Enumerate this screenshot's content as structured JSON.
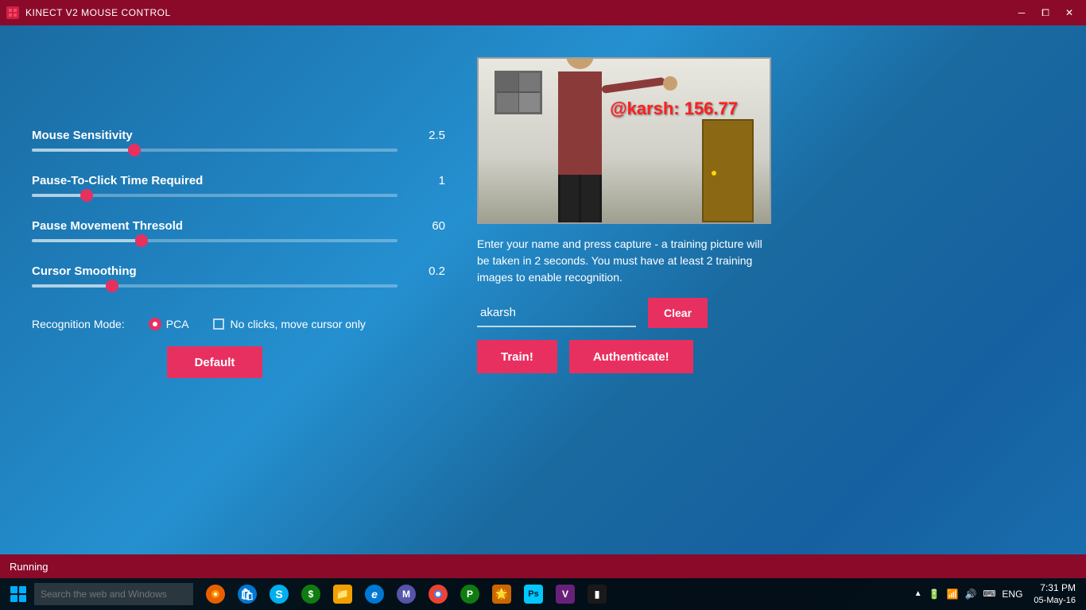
{
  "titleBar": {
    "title": "KINECT V2 MOUSE CONTROL",
    "minBtn": "─",
    "maxBtn": "⧠",
    "closeBtn": "✕"
  },
  "sliders": [
    {
      "label": "Mouse Sensitivity",
      "value": "2.5",
      "thumbPercent": 28
    },
    {
      "label": "Pause-To-Click Time Required",
      "value": "1",
      "thumbPercent": 15
    },
    {
      "label": "Pause Movement Thresold",
      "value": "60",
      "thumbPercent": 30
    },
    {
      "label": "Cursor Smoothing",
      "value": "0.2",
      "thumbPercent": 22
    }
  ],
  "recognitionMode": {
    "label": "Recognition Mode:",
    "selected": "PCA",
    "checkboxLabel": "No clicks, move cursor only"
  },
  "defaultBtn": "Default",
  "cameraOverlay": "@karsh: 156.77",
  "instructions": "Enter your name and press capture - a training picture will be taken in 2 seconds.  You must have at least 2 training images to enable recognition.",
  "nameInput": {
    "value": "akarsh",
    "placeholder": ""
  },
  "clearBtn": "Clear",
  "trainBtn": "Train!",
  "authenticateBtn": "Authenticate!",
  "status": "Running",
  "taskbar": {
    "searchPlaceholder": "Search the web and Windows",
    "time": "7:31 PM",
    "date": "05-May-16",
    "language": "ENG"
  },
  "icons": {
    "firefox": {
      "color": "#e66000",
      "letter": "F"
    },
    "store": {
      "color": "#0078d4",
      "letter": "S"
    },
    "skype": {
      "color": "#00aff0",
      "letter": "S"
    },
    "finance": {
      "color": "#107c10",
      "letter": "$"
    },
    "explorer": {
      "color": "#f0a000",
      "letter": "E"
    },
    "edge": {
      "color": "#0078d4",
      "letter": "e"
    },
    "travel": {
      "color": "#6666aa",
      "letter": "M"
    },
    "chrome": {
      "color": "#ea4335",
      "letter": "G"
    },
    "greenapp": {
      "color": "#107c10",
      "letter": "P"
    },
    "photos": {
      "color": "#cc6600",
      "letter": "P"
    },
    "photoshop": {
      "color": "#00c8ff",
      "letter": "Ps"
    },
    "vs": {
      "color": "#68217a",
      "letter": "V"
    },
    "terminal": {
      "color": "#1a1a1a",
      "letter": "▮"
    }
  }
}
